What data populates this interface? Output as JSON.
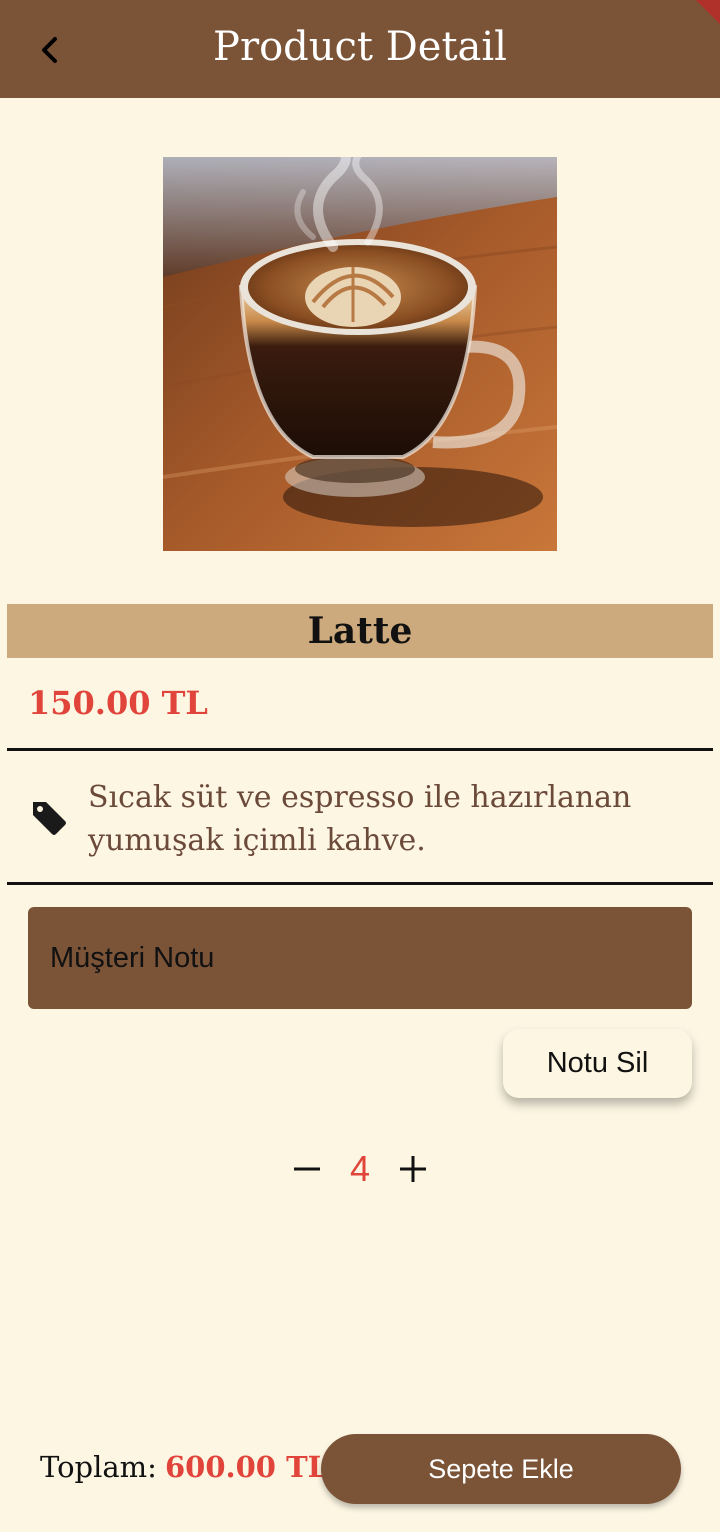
{
  "appbar": {
    "title": "Product Detail",
    "back_icon": "chevron-left-icon",
    "color": "#7B5438"
  },
  "product": {
    "image_subject": "latte-cup-image",
    "name": "Latte",
    "price": "150.00 TL",
    "description": "Sıcak süt ve espresso ile hazırlanan yumuşak içimli kahve.",
    "description_icon": "tag-icon"
  },
  "note": {
    "placeholder": "Müşteri Notu",
    "value": "",
    "delete_label": "Notu Sil"
  },
  "quantity": {
    "value": "4",
    "decrement_icon": "minus-icon",
    "increment_icon": "plus-icon"
  },
  "footer": {
    "total_label": "Toplam:",
    "total_value": "600.00 TL",
    "add_to_cart_label": "Sepete Ekle"
  },
  "colors": {
    "background": "#FDF6E3",
    "primary_brown": "#7B5438",
    "name_bar": "#CDAA7D",
    "accent_red": "#E0443A",
    "description_text": "#6B4A3A"
  }
}
